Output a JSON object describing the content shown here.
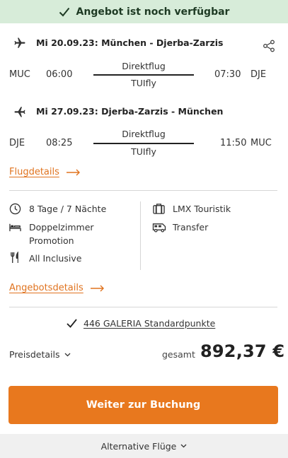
{
  "banner": {
    "text": "Angebot ist noch verfügbar"
  },
  "outbound": {
    "title": "Mi 20.09.23: München - Djerba-Zarzis",
    "from_code": "MUC",
    "dep_time": "06:00",
    "type": "Direktflug",
    "airline": "TUIfly",
    "arr_time": "07:30",
    "to_code": "DJE"
  },
  "inbound": {
    "title": "Mi 27.09.23: Djerba-Zarzis - München",
    "from_code": "DJE",
    "dep_time": "08:25",
    "type": "Direktflug",
    "airline": "TUIfly",
    "arr_time": "11:50",
    "to_code": "MUC"
  },
  "links": {
    "flight_details": "Flugdetails",
    "offer_details": "Angebotsdetails"
  },
  "features": {
    "duration": "8 Tage / 7 Nächte",
    "room_line1": "Doppelzimmer",
    "room_line2": "Promotion",
    "board": "All Inclusive",
    "operator": "LMX Touristik",
    "transfer": "Transfer"
  },
  "points": {
    "text": "446 GALERIA Standardpunkte"
  },
  "price": {
    "details_label": "Preisdetails",
    "total_label": "gesamt",
    "amount": "892,37 €"
  },
  "cta": {
    "label": "Weiter zur Buchung"
  },
  "footer": {
    "label": "Alternative Flüge"
  },
  "colors": {
    "accent": "#e8781e",
    "banner_bg": "#d7ecd9",
    "footer_bg": "#f0f0f0"
  }
}
